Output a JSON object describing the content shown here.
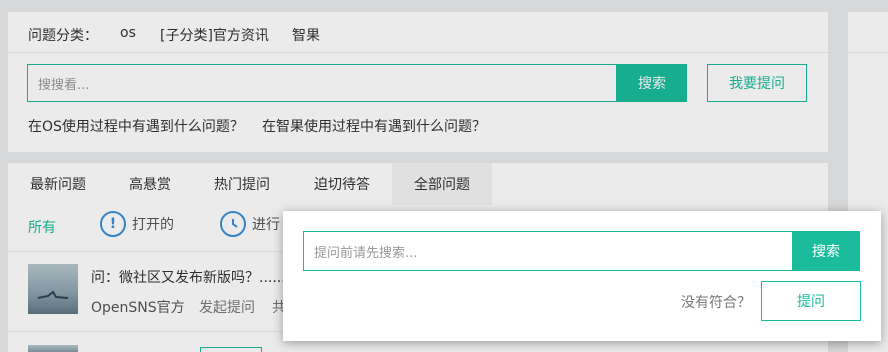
{
  "categories": {
    "label": "问题分类：",
    "items": [
      "os",
      "[子分类]官方资讯",
      "智果"
    ]
  },
  "search": {
    "placeholder": "搜搜看...",
    "button": "搜索",
    "ask_button": "我要提问"
  },
  "quick_questions": [
    "在OS使用过程中有遇到什么问题？",
    "在智果使用过程中有遇到什么问题？"
  ],
  "tabs": [
    "最新问题",
    "高悬赏",
    "热门提问",
    "迫切待答",
    "全部问题"
  ],
  "filters": {
    "all": "所有",
    "open": "打开的",
    "in_progress": "进行"
  },
  "questions": [
    {
      "title": "问：微社区又发布新版吗？......",
      "author": "OpenSNS官方",
      "action": "发起提问",
      "extra": "共"
    }
  ],
  "modal": {
    "placeholder": "提问前请先搜索...",
    "search_button": "搜索",
    "no_match": "没有符合？",
    "ask_button": "提问"
  },
  "colors": {
    "accent": "#1abc9c",
    "link_blue": "#3a8fd6"
  }
}
